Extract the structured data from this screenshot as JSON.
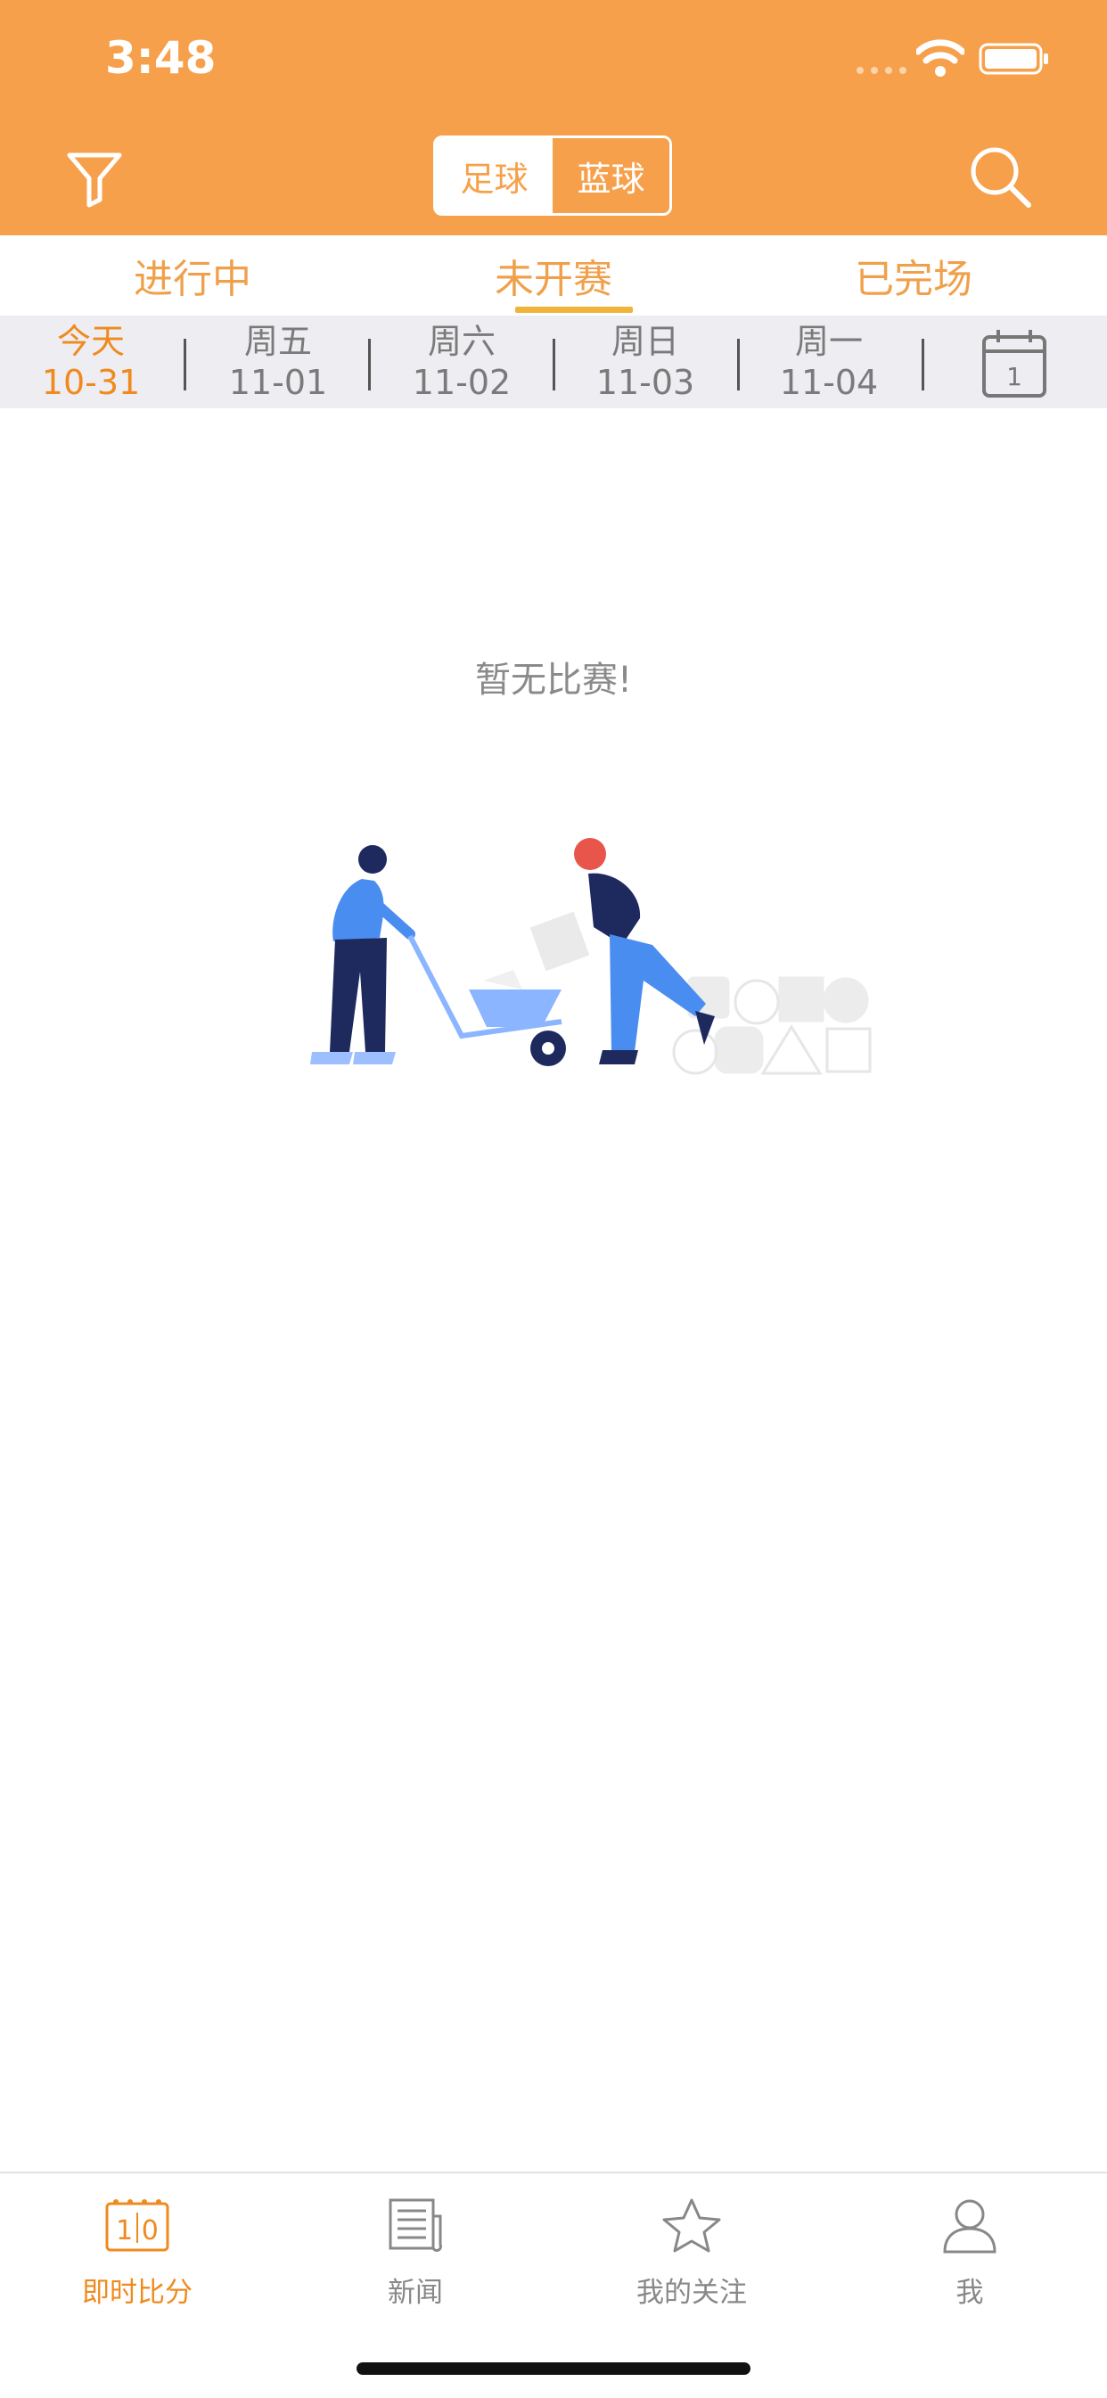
{
  "status_bar": {
    "time": "3:48"
  },
  "header": {
    "sport_tabs": [
      "足球",
      "蓝球"
    ],
    "selected_sport": "足球"
  },
  "status_tabs": {
    "items": [
      "进行中",
      "未开赛",
      "已完场"
    ],
    "selected": "未开赛"
  },
  "date_strip": {
    "days": [
      {
        "weekday": "今天",
        "date": "10-31"
      },
      {
        "weekday": "周五",
        "date": "11-01"
      },
      {
        "weekday": "周六",
        "date": "11-02"
      },
      {
        "weekday": "周日",
        "date": "11-03"
      },
      {
        "weekday": "周一",
        "date": "11-04"
      }
    ],
    "selected_index": 0,
    "calendar_icon_number": "1"
  },
  "empty_state": {
    "message": "暂无比赛!"
  },
  "tab_bar": {
    "items": [
      {
        "label": "即时比分",
        "icon": "scoreboard-icon",
        "icon_text": "1 0"
      },
      {
        "label": "新闻",
        "icon": "newspaper-icon"
      },
      {
        "label": "我的关注",
        "icon": "star-icon"
      },
      {
        "label": "我",
        "icon": "person-icon"
      }
    ],
    "selected_index": 0
  },
  "colors": {
    "primary": "#F7A04B",
    "active_text": "#F08A1F",
    "tab_underline": "#F1B43B",
    "date_strip_bg": "#EEEEF2",
    "inactive_text": "#888888"
  }
}
